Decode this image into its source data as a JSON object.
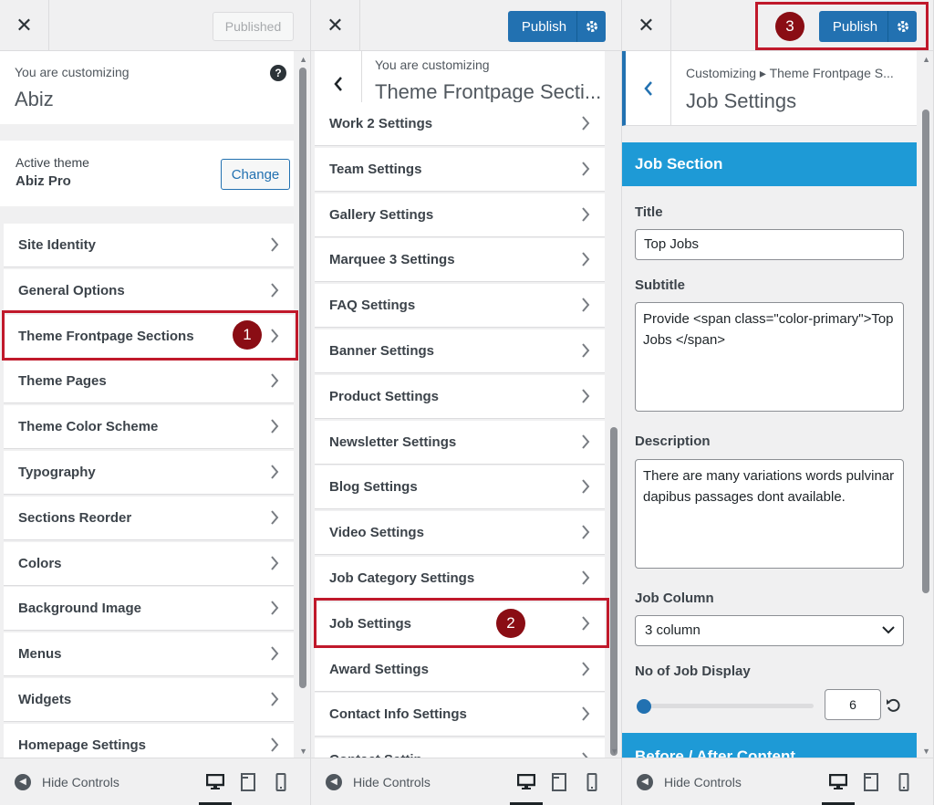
{
  "panel1": {
    "published_label": "Published",
    "customizing_label": "You are customizing",
    "site_name": "Abiz",
    "active_theme_label": "Active theme",
    "active_theme_name": "Abiz Pro",
    "change_label": "Change",
    "items": [
      {
        "label": "Site Identity"
      },
      {
        "label": "General Options"
      },
      {
        "label": "Theme Frontpage Sections"
      },
      {
        "label": "Theme Pages"
      },
      {
        "label": "Theme Color Scheme"
      },
      {
        "label": "Typography"
      },
      {
        "label": "Sections Reorder"
      },
      {
        "label": "Colors"
      },
      {
        "label": "Background Image"
      },
      {
        "label": "Menus"
      },
      {
        "label": "Widgets"
      },
      {
        "label": "Homepage Settings"
      }
    ],
    "badge": "1"
  },
  "panel2": {
    "publish_label": "Publish",
    "customizing_label": "You are customizing",
    "section_title": "Theme Frontpage Secti...",
    "items": [
      {
        "label": "Work 2 Settings"
      },
      {
        "label": "Team Settings"
      },
      {
        "label": "Gallery Settings"
      },
      {
        "label": "Marquee 3 Settings"
      },
      {
        "label": "FAQ Settings"
      },
      {
        "label": "Banner Settings"
      },
      {
        "label": "Product Settings"
      },
      {
        "label": "Newsletter Settings"
      },
      {
        "label": "Blog Settings"
      },
      {
        "label": "Video Settings"
      },
      {
        "label": "Job Category Settings"
      },
      {
        "label": "Job Settings"
      },
      {
        "label": "Award Settings"
      },
      {
        "label": "Contact Info Settings"
      },
      {
        "label": "Contact Settin..."
      }
    ],
    "badge": "2"
  },
  "panel3": {
    "publish_label": "Publish",
    "breadcrumb": "Customizing ▸ Theme Frontpage S...",
    "title": "Job Settings",
    "section_header": "Job Section",
    "title_label": "Title",
    "title_value": "Top Jobs",
    "subtitle_label": "Subtitle",
    "subtitle_value": "Provide  <span class=\"color-primary\">Top Jobs </span>",
    "description_label": "Description",
    "description_value": "There are many variations words pulvinar dapibus passages dont available.",
    "job_column_label": "Job Column",
    "job_column_value": "3 column",
    "job_display_label": "No of Job Display",
    "job_display_value": "6",
    "next_section": "Before / After Content",
    "badge": "3"
  },
  "footer": {
    "hide_controls": "Hide Controls"
  },
  "colors": {
    "accent": "#2271b1",
    "section_header": "#1e9ad6",
    "highlight": "#c0192b",
    "badge": "#8a0d14"
  }
}
